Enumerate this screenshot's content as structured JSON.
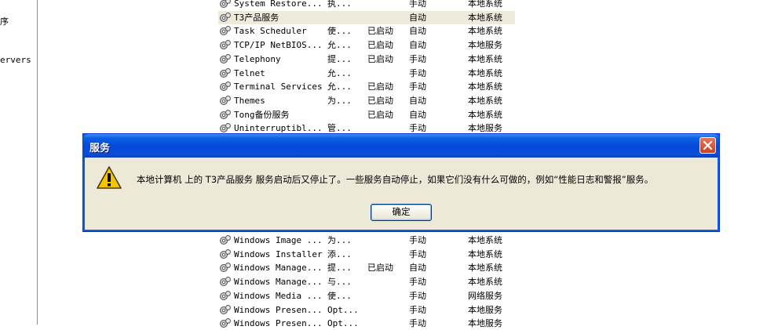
{
  "left_pane": {
    "labels": [
      "序",
      "ervers"
    ]
  },
  "services_top": [
    {
      "name": "System Restore...",
      "desc": "执...",
      "status": "",
      "startup": "手动",
      "logon": "本地系统",
      "selected": false
    },
    {
      "name": "T3产品服务",
      "desc": "",
      "status": "",
      "startup": "自动",
      "logon": "本地系统",
      "selected": true
    },
    {
      "name": "Task Scheduler",
      "desc": "使...",
      "status": "已启动",
      "startup": "自动",
      "logon": "本地系统",
      "selected": false
    },
    {
      "name": "TCP/IP NetBIOS...",
      "desc": "允...",
      "status": "已启动",
      "startup": "自动",
      "logon": "本地服务",
      "selected": false
    },
    {
      "name": "Telephony",
      "desc": "提...",
      "status": "已启动",
      "startup": "手动",
      "logon": "本地系统",
      "selected": false
    },
    {
      "name": "Telnet",
      "desc": "允...",
      "status": "",
      "startup": "手动",
      "logon": "本地系统",
      "selected": false
    },
    {
      "name": "Terminal Services",
      "desc": "允...",
      "status": "已启动",
      "startup": "手动",
      "logon": "本地系统",
      "selected": false
    },
    {
      "name": "Themes",
      "desc": "为...",
      "status": "已启动",
      "startup": "自动",
      "logon": "本地系统",
      "selected": false
    },
    {
      "name": "Tong备份服务",
      "desc": "",
      "status": "已启动",
      "startup": "自动",
      "logon": "本地系统",
      "selected": false
    },
    {
      "name": "Uninterruptibl...",
      "desc": "管...",
      "status": "",
      "startup": "手动",
      "logon": "本地服务",
      "selected": false
    }
  ],
  "services_bottom": [
    {
      "name": "Windows Image ...",
      "desc": "为...",
      "status": "",
      "startup": "手动",
      "logon": "本地系统"
    },
    {
      "name": "Windows Installer",
      "desc": "添...",
      "status": "",
      "startup": "手动",
      "logon": "本地系统"
    },
    {
      "name": "Windows Manage...",
      "desc": "提...",
      "status": "已启动",
      "startup": "自动",
      "logon": "本地系统"
    },
    {
      "name": "Windows Manage...",
      "desc": "与...",
      "status": "",
      "startup": "手动",
      "logon": "本地系统"
    },
    {
      "name": "Windows Media ...",
      "desc": "使...",
      "status": "",
      "startup": "手动",
      "logon": "网络服务"
    },
    {
      "name": "Windows Presen...",
      "desc": "Opt...",
      "status": "",
      "startup": "手动",
      "logon": "本地服务"
    },
    {
      "name": "Windows Presen...",
      "desc": "Opt...",
      "status": "",
      "startup": "手动",
      "logon": "本地服务"
    }
  ],
  "dialog": {
    "title": "服务",
    "message": "本地计算机 上的 T3产品服务 服务启动后又停止了。一些服务自动停止，如果它们没有什么可做的，例如“性能日志和警报”服务。",
    "ok_label": "确定",
    "icon": "warning-icon"
  },
  "colors": {
    "titlebar": "#0548d8",
    "dialog_bg": "#ece9d8",
    "selected_row": "#eeebdc",
    "close_button": "#c8431f",
    "warning": "#f5c400"
  }
}
